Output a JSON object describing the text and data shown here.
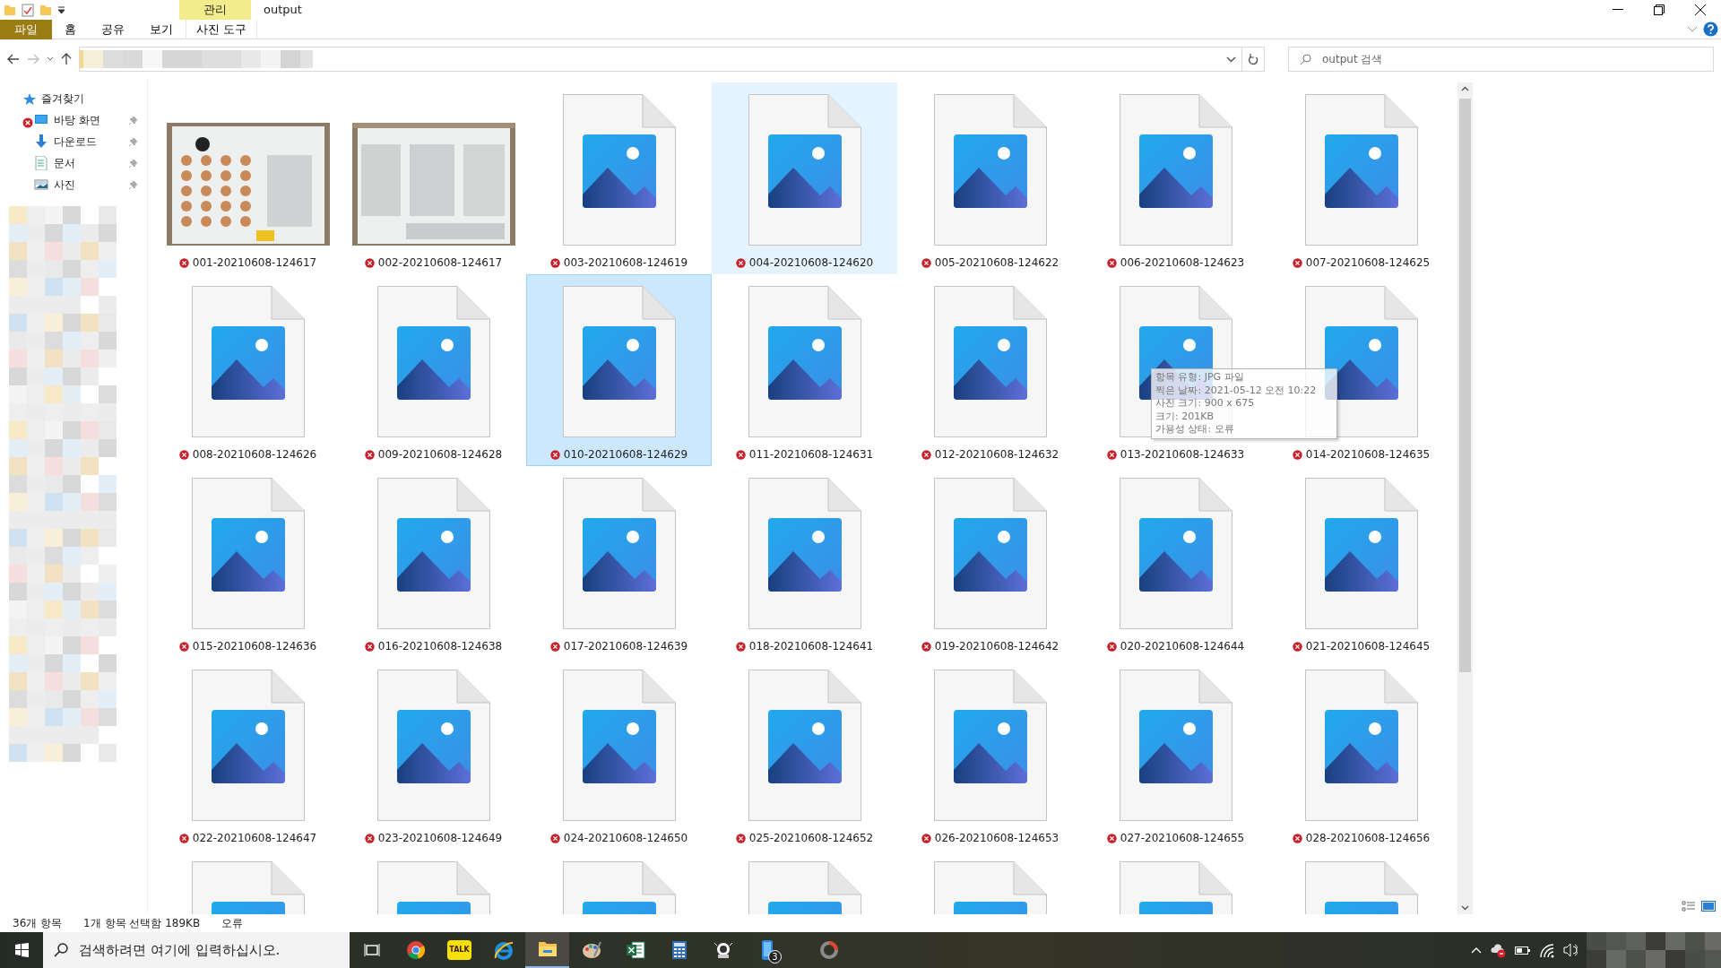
{
  "window": {
    "title": "output",
    "context_label": "관리"
  },
  "ribbon_tabs": [
    {
      "label": "파일",
      "selected": true,
      "kind": "file"
    },
    {
      "label": "홈",
      "selected": false,
      "kind": "normal"
    },
    {
      "label": "공유",
      "selected": false,
      "kind": "normal"
    },
    {
      "label": "보기",
      "selected": false,
      "kind": "normal"
    },
    {
      "label": "사진 도구",
      "selected": false,
      "kind": "contextual"
    }
  ],
  "search": {
    "placeholder": "output 검색"
  },
  "sidebar": {
    "header": "즐겨찾기",
    "items": [
      {
        "label": "바탕 화면",
        "kind": "desktop",
        "pinned": true,
        "error": true
      },
      {
        "label": "다운로드",
        "kind": "downloads",
        "pinned": true,
        "error": false
      },
      {
        "label": "문서",
        "kind": "documents",
        "pinned": true,
        "error": false
      },
      {
        "label": "사진",
        "kind": "pictures",
        "pinned": true,
        "error": false
      }
    ]
  },
  "files": [
    {
      "name": "001-20210608-124617",
      "kind": "thumbnail",
      "error": true,
      "selected": false,
      "hovered": false
    },
    {
      "name": "002-20210608-124617",
      "kind": "thumbnail",
      "error": true,
      "selected": false,
      "hovered": false
    },
    {
      "name": "003-20210608-124619",
      "kind": "generic",
      "error": true,
      "selected": false,
      "hovered": false
    },
    {
      "name": "004-20210608-124620",
      "kind": "generic",
      "error": true,
      "selected": false,
      "hovered": true
    },
    {
      "name": "005-20210608-124622",
      "kind": "generic",
      "error": true,
      "selected": false,
      "hovered": false
    },
    {
      "name": "006-20210608-124623",
      "kind": "generic",
      "error": true,
      "selected": false,
      "hovered": false
    },
    {
      "name": "007-20210608-124625",
      "kind": "generic",
      "error": true,
      "selected": false,
      "hovered": false
    },
    {
      "name": "008-20210608-124626",
      "kind": "generic",
      "error": true,
      "selected": false,
      "hovered": false
    },
    {
      "name": "009-20210608-124628",
      "kind": "generic",
      "error": true,
      "selected": false,
      "hovered": false
    },
    {
      "name": "010-20210608-124629",
      "kind": "generic",
      "error": true,
      "selected": true,
      "hovered": false
    },
    {
      "name": "011-20210608-124631",
      "kind": "generic",
      "error": true,
      "selected": false,
      "hovered": false
    },
    {
      "name": "012-20210608-124632",
      "kind": "generic",
      "error": true,
      "selected": false,
      "hovered": false
    },
    {
      "name": "013-20210608-124633",
      "kind": "generic",
      "error": true,
      "selected": false,
      "hovered": false,
      "tooltip": [
        "항목 유형: JPG 파일",
        "찍은 날짜: 2021-05-12 오전 10:22",
        "사진 크기: 900 x 675",
        "크기: 201KB",
        "가용성 상태: 오류"
      ]
    },
    {
      "name": "014-20210608-124635",
      "kind": "generic",
      "error": true,
      "selected": false,
      "hovered": false
    },
    {
      "name": "015-20210608-124636",
      "kind": "generic",
      "error": true,
      "selected": false,
      "hovered": false
    },
    {
      "name": "016-20210608-124638",
      "kind": "generic",
      "error": true,
      "selected": false,
      "hovered": false
    },
    {
      "name": "017-20210608-124639",
      "kind": "generic",
      "error": true,
      "selected": false,
      "hovered": false
    },
    {
      "name": "018-20210608-124641",
      "kind": "generic",
      "error": true,
      "selected": false,
      "hovered": false
    },
    {
      "name": "019-20210608-124642",
      "kind": "generic",
      "error": true,
      "selected": false,
      "hovered": false
    },
    {
      "name": "020-20210608-124644",
      "kind": "generic",
      "error": true,
      "selected": false,
      "hovered": false
    },
    {
      "name": "021-20210608-124645",
      "kind": "generic",
      "error": true,
      "selected": false,
      "hovered": false
    },
    {
      "name": "022-20210608-124647",
      "kind": "generic",
      "error": true,
      "selected": false,
      "hovered": false
    },
    {
      "name": "023-20210608-124649",
      "kind": "generic",
      "error": true,
      "selected": false,
      "hovered": false
    },
    {
      "name": "024-20210608-124650",
      "kind": "generic",
      "error": true,
      "selected": false,
      "hovered": false
    },
    {
      "name": "025-20210608-124652",
      "kind": "generic",
      "error": true,
      "selected": false,
      "hovered": false
    },
    {
      "name": "026-20210608-124653",
      "kind": "generic",
      "error": true,
      "selected": false,
      "hovered": false
    },
    {
      "name": "027-20210608-124655",
      "kind": "generic",
      "error": true,
      "selected": false,
      "hovered": false
    },
    {
      "name": "028-20210608-124656",
      "kind": "generic",
      "error": true,
      "selected": false,
      "hovered": false
    },
    {
      "kind": "generic",
      "selected": false,
      "hovered": false
    },
    {
      "kind": "generic",
      "selected": false,
      "hovered": false
    },
    {
      "kind": "generic",
      "selected": false,
      "hovered": false
    },
    {
      "kind": "generic",
      "selected": false,
      "hovered": false
    },
    {
      "kind": "generic",
      "selected": false,
      "hovered": false
    },
    {
      "kind": "generic",
      "selected": false,
      "hovered": false
    },
    {
      "kind": "generic",
      "selected": false,
      "hovered": false
    }
  ],
  "status_bar": {
    "count": "36개 항목",
    "selection": "1개 항목 선택함 189KB",
    "status": "오류"
  },
  "taskbar": {
    "search_placeholder": "검색하려면 여기에 입력하십시오.",
    "apps": [
      {
        "kind": "taskview",
        "active": false
      },
      {
        "kind": "chrome",
        "active": false
      },
      {
        "kind": "talk",
        "text": "TALK",
        "active": false
      },
      {
        "kind": "ie",
        "active": false
      },
      {
        "kind": "explorer",
        "active": true
      },
      {
        "kind": "paint",
        "active": false
      },
      {
        "kind": "excel",
        "active": false
      },
      {
        "kind": "calculator",
        "active": false
      },
      {
        "kind": "robot",
        "active": false
      },
      {
        "kind": "phone",
        "badge": "3",
        "active": false
      },
      {
        "kind": "ring",
        "active": false
      }
    ]
  }
}
